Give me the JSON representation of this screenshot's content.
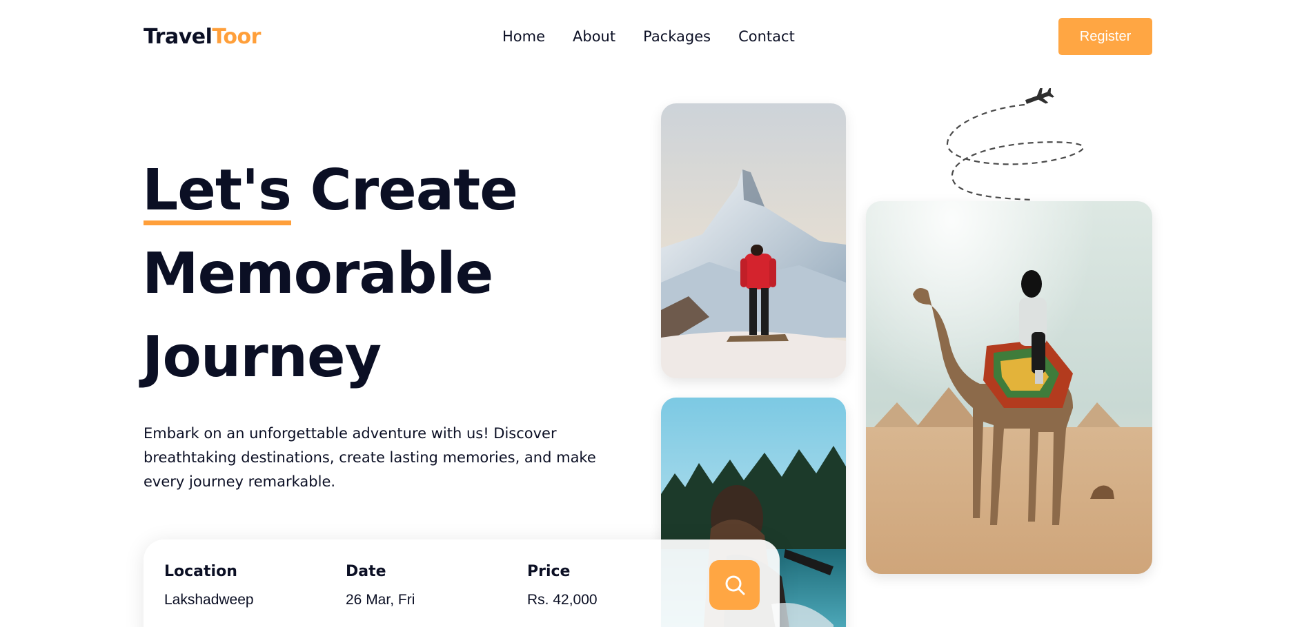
{
  "brand": {
    "part1": "Travel",
    "part2": "Toor"
  },
  "nav": {
    "items": [
      "Home",
      "About",
      "Packages",
      "Contact"
    ]
  },
  "header": {
    "register_label": "Register"
  },
  "hero": {
    "headline_part1": "Let's",
    "headline_part2": " Create",
    "headline_line2": "Memorable",
    "headline_line3": "Journey",
    "description": "Embark on an unforgettable adventure with us! Discover breathtaking destinations, create lasting memories, and make every journey remarkable."
  },
  "search": {
    "location_label": "Location",
    "location_value": "Lakshadweep",
    "date_label": "Date",
    "date_value": "26 Mar, Fri",
    "price_label": "Price",
    "price_value": "Rs. 42,000"
  },
  "icons": {
    "search": "search-icon",
    "airplane": "airplane-icon"
  },
  "colors": {
    "accent": "#ffa643",
    "text": "#0b0f24"
  }
}
